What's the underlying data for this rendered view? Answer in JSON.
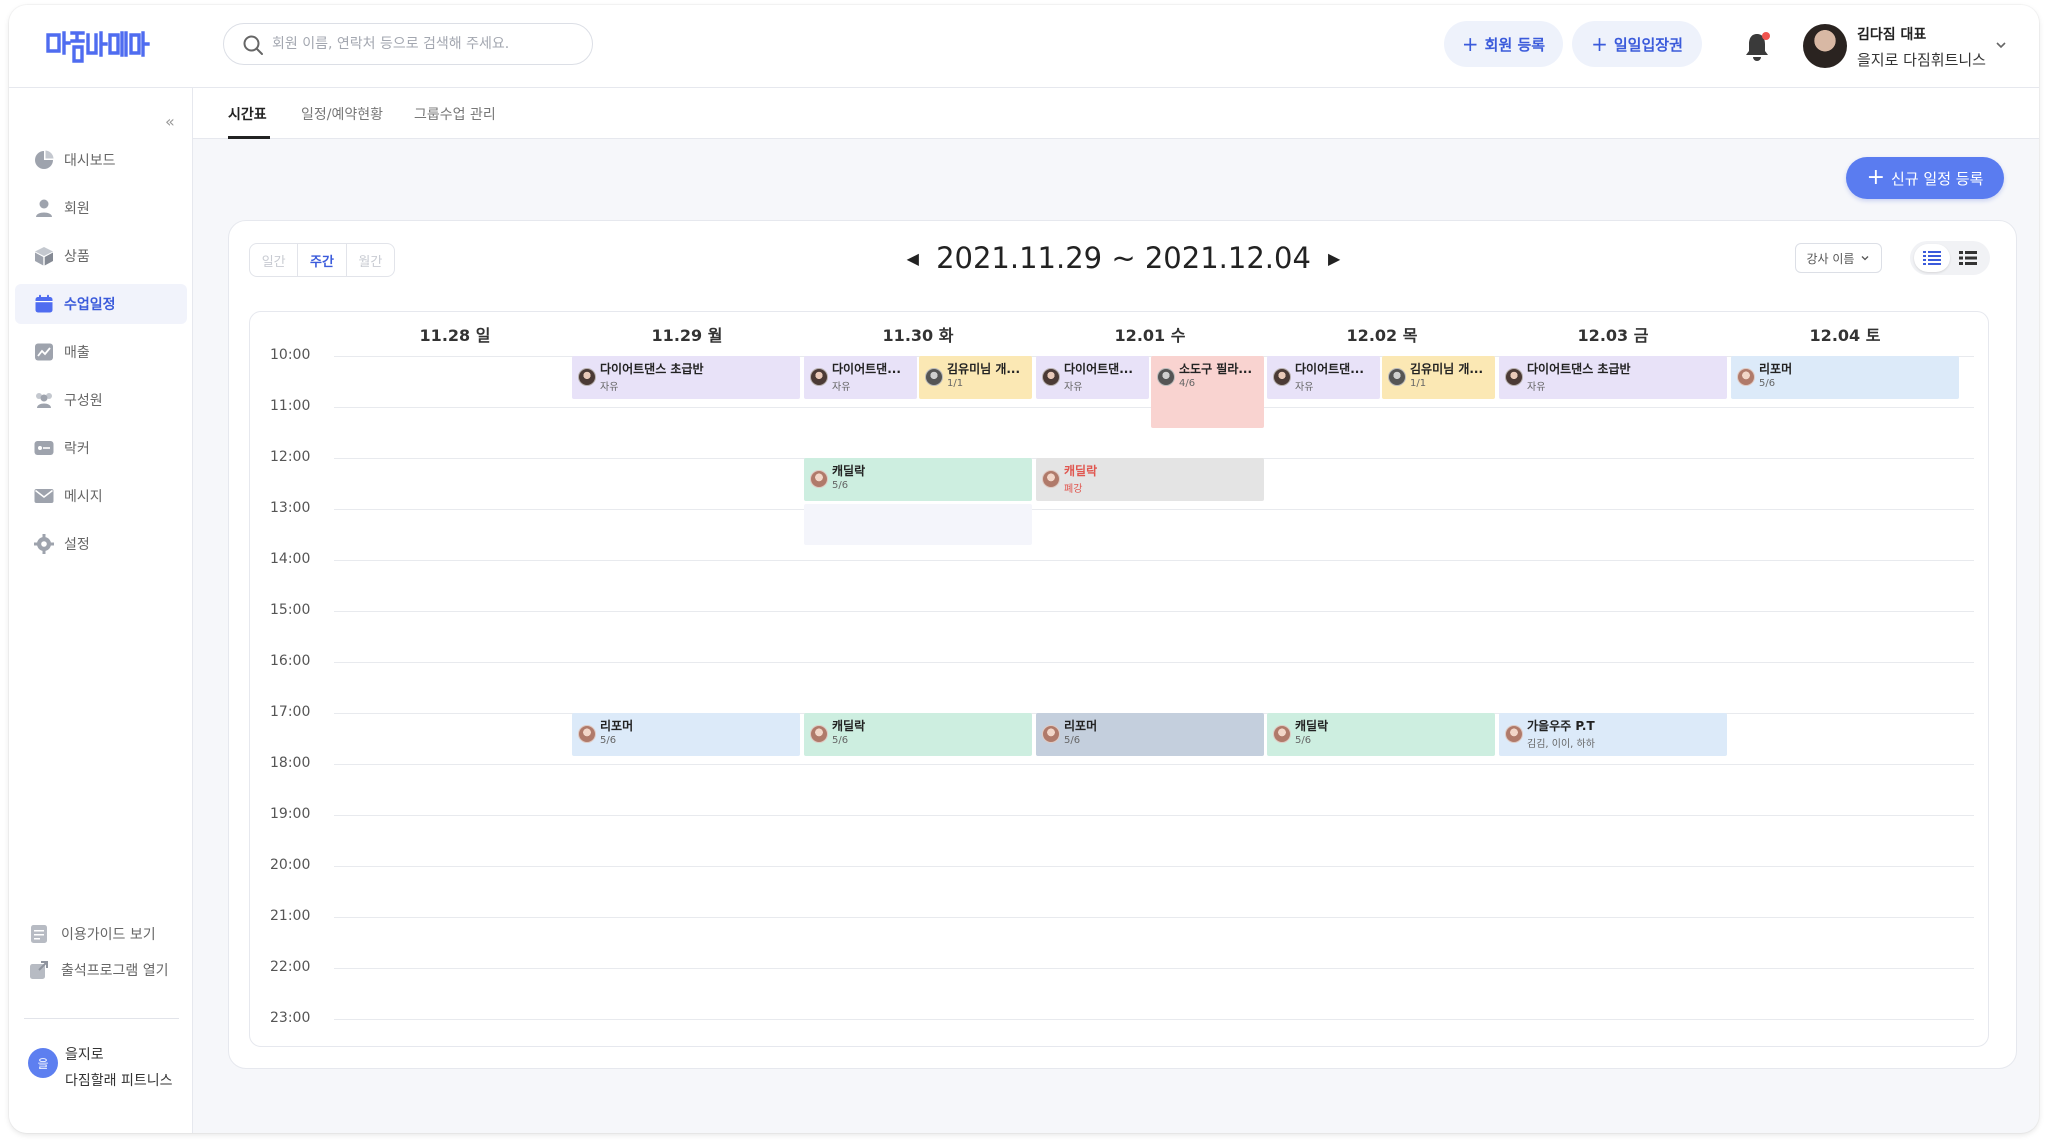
{
  "header": {
    "search_placeholder": "회원 이름, 연락처 등으로 검색해 주세요.",
    "btn_member": "회원 등록",
    "btn_daypass": "일일입장권",
    "profile_name": "김다짐 대표",
    "profile_gym": "을지로 다짐휘트니스"
  },
  "sidebar": {
    "collapse": "«",
    "items": [
      {
        "label": "대시보드",
        "icon": "pie-chart-icon"
      },
      {
        "label": "회원",
        "icon": "person-icon"
      },
      {
        "label": "상품",
        "icon": "box-icon"
      },
      {
        "label": "수업일정",
        "icon": "calendar-icon"
      },
      {
        "label": "매출",
        "icon": "sales-chart-icon"
      },
      {
        "label": "구성원",
        "icon": "team-icon"
      },
      {
        "label": "락커",
        "icon": "locker-icon"
      },
      {
        "label": "메시지",
        "icon": "mail-icon"
      },
      {
        "label": "설정",
        "icon": "gear-icon"
      }
    ],
    "guide": "이용가이드 보기",
    "attendance": "출석프로그램 열기",
    "branch_initial": "을",
    "branch_line1": "을지로",
    "branch_line2": "다짐할래 피트니스"
  },
  "tabs": [
    "시간표",
    "일정/예약현황",
    "그룹수업 관리"
  ],
  "new_schedule_button": "신규 일정 등록",
  "calendar": {
    "modes": [
      "일간",
      "주간",
      "월간"
    ],
    "range": "2021.11.29 ~ 2021.12.04",
    "teacher_filter": "강사 이름",
    "days": [
      "11.28 일",
      "11.29 월",
      "11.30 화",
      "12.01 수",
      "12.02 목",
      "12.03 금",
      "12.04 토"
    ],
    "times": [
      "10:00",
      "11:00",
      "12:00",
      "13:00",
      "14:00",
      "15:00",
      "16:00",
      "17:00",
      "18:00",
      "19:00",
      "20:00",
      "21:00",
      "22:00",
      "23:00"
    ],
    "events": [
      {
        "title": "다이어트댄스 초급반",
        "sub": "자유"
      },
      {
        "title": "다이어트댄...",
        "sub": "자유"
      },
      {
        "title": "김유미님 개...",
        "sub": "1/1"
      },
      {
        "title": "다이어트댄...",
        "sub": "자유"
      },
      {
        "title": "소도구 필라...",
        "sub": "4/6"
      },
      {
        "title": "다이어트댄...",
        "sub": "자유"
      },
      {
        "title": "김유미님 개...",
        "sub": "1/1"
      },
      {
        "title": "다이어트댄스 초급반",
        "sub": "자유"
      },
      {
        "title": "리포머",
        "sub": "5/6"
      },
      {
        "title": "캐딜락",
        "sub": "5/6"
      },
      {
        "title": "캐딜락",
        "sub": "폐강"
      },
      {
        "title": "리포머",
        "sub": "5/6"
      },
      {
        "title": "캐딜락",
        "sub": "5/6"
      },
      {
        "title": "리포머",
        "sub": "5/6"
      },
      {
        "title": "캐딜락",
        "sub": "5/6"
      },
      {
        "title": "가을우주 P.T",
        "sub": "김김, 이이, 하하"
      }
    ]
  },
  "colors": {
    "accent": "#5a7cf0",
    "lavender": "#e8e2f8",
    "yellow": "#fbe8b4",
    "pink": "#f9d3d0",
    "blue": "#dceaf9",
    "mint": "#cdeee0",
    "gray": "#e4e4e4",
    "slate": "#c4cfdd"
  }
}
